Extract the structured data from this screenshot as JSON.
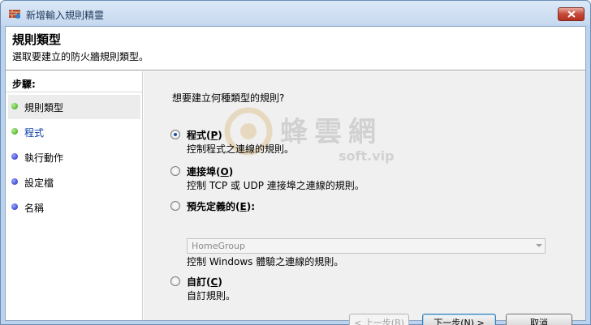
{
  "window": {
    "title": "新增輸入規則精靈",
    "close_icon": "close-icon"
  },
  "header": {
    "title": "規則類型",
    "subtitle": "選取要建立的防火牆規則類型。"
  },
  "sidebar": {
    "steps_label": "步驟:",
    "steps": [
      {
        "label": "規則類型",
        "dot": "green",
        "active": true
      },
      {
        "label": "程式",
        "dot": "green",
        "active": false
      },
      {
        "label": "執行動作",
        "dot": "blue",
        "active": false
      },
      {
        "label": "設定檔",
        "dot": "blue",
        "active": false
      },
      {
        "label": "名稱",
        "dot": "blue",
        "active": false
      }
    ]
  },
  "main": {
    "question": "想要建立何種類型的規則?",
    "options": [
      {
        "label": "程式",
        "accel": "P",
        "desc": "控制程式之連線的規則。",
        "checked": true
      },
      {
        "label": "連接埠",
        "accel": "O",
        "desc": "控制 TCP 或 UDP 連接埠之連線的規則。",
        "checked": false
      },
      {
        "label": "預先定義的",
        "accel": "E",
        "suffix": ":",
        "desc": "控制 Windows 體驗之連線的規則。",
        "checked": false
      },
      {
        "label": "自訂",
        "accel": "C",
        "desc": "自訂規則。",
        "checked": false
      }
    ],
    "predefined_select_value": "HomeGroup"
  },
  "buttons": {
    "back": "< 上一步(B)",
    "next": "下一步(N) >",
    "cancel": "取消"
  },
  "watermark": {
    "text": "蜂雲網",
    "sub": "soft.vip"
  },
  "colors": {
    "title_bar": "#c7d9ef",
    "close_button": "#c4493a",
    "panel": "#f0f0f0",
    "step_green": "#2f9a12",
    "step_blue": "#1b27b8"
  }
}
